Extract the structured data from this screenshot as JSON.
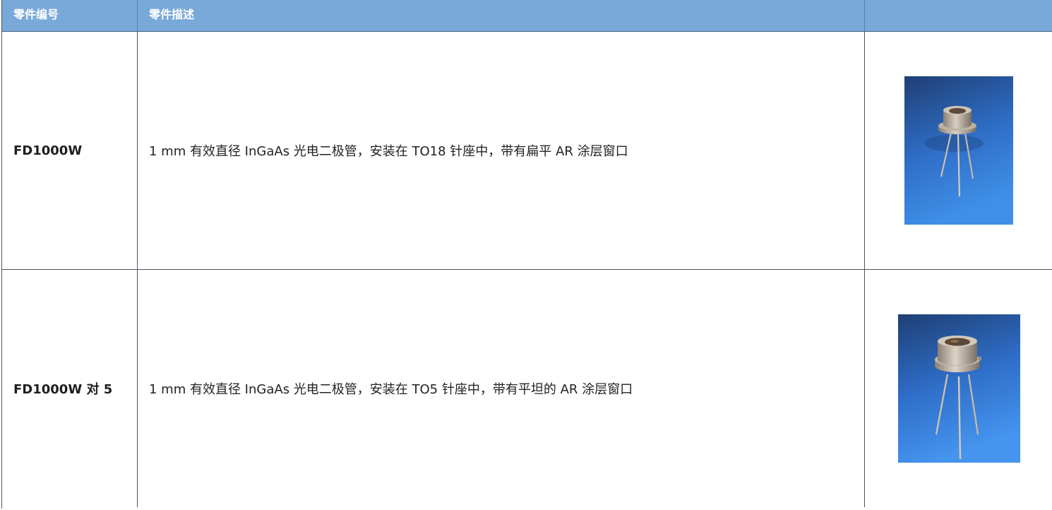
{
  "table": {
    "headers": [
      "零件编号",
      "零件描述",
      ""
    ],
    "rows": [
      {
        "part_number": "FD1000W",
        "description": "1 mm 有效直径 InGaAs 光电二极管，安装在 TO18 针座中，带有扁平 AR 涂层窗口",
        "image": "photodiode-to18-photo"
      },
      {
        "part_number": "FD1000W 对 5",
        "description": "1 mm 有效直径 InGaAs 光电二极管，安装在 TO5 针座中，带有平坦的 AR 涂层窗口",
        "image": "photodiode-to5-photo"
      }
    ]
  },
  "colors": {
    "header_bg": "#79a9d9",
    "header_text": "#ffffff",
    "photo_bg_top": "#1f3f75",
    "photo_bg_bottom": "#3f8fe8"
  }
}
